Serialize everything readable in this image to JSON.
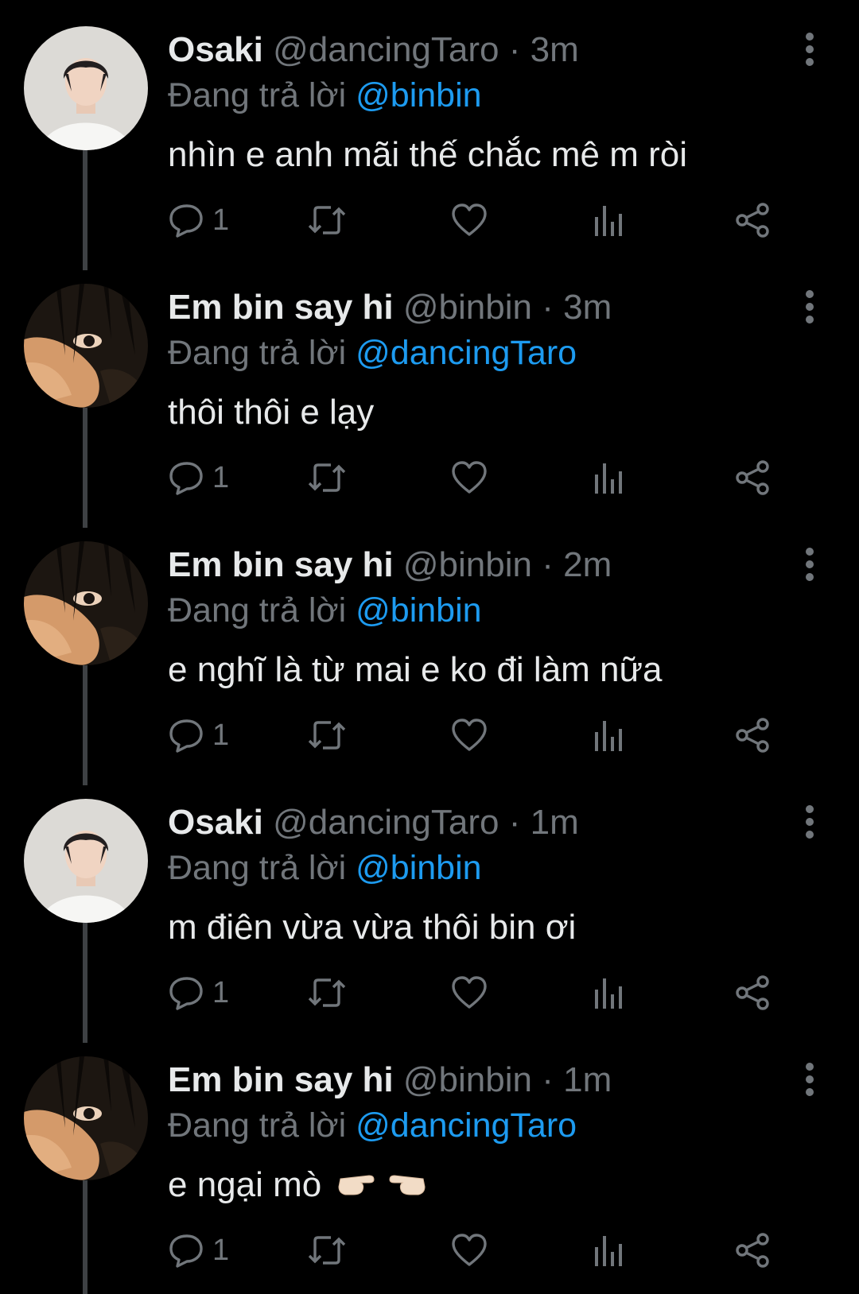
{
  "colors": {
    "background": "#000000",
    "primary_text": "#e7e9ea",
    "secondary_text": "#71767b",
    "link": "#1d9bf0",
    "thread_line": "#3e4144"
  },
  "tweets": [
    {
      "name": "Osaki",
      "handle": "@dancingTaro",
      "dot": "·",
      "time": "3m",
      "reply_prefix": "Đang trả lời",
      "reply_to": "@binbin",
      "text": "nhìn e anh mãi thế chắc mê m ròi",
      "reply_count": "1",
      "avatar": "osaki-avatar",
      "icons": [
        "reply-icon",
        "retweet-icon",
        "like-icon",
        "views-icon",
        "share-icon",
        "more-icon"
      ]
    },
    {
      "name": "Em bin say hi",
      "handle": "@binbin",
      "dot": "·",
      "time": "3m",
      "reply_prefix": "Đang trả lời",
      "reply_to": "@dancingTaro",
      "text": "thôi thôi e lạy",
      "reply_count": "1",
      "avatar": "binbin-avatar",
      "icons": [
        "reply-icon",
        "retweet-icon",
        "like-icon",
        "views-icon",
        "share-icon",
        "more-icon"
      ]
    },
    {
      "name": "Em bin say hi",
      "handle": "@binbin",
      "dot": "·",
      "time": "2m",
      "reply_prefix": "Đang trả lời",
      "reply_to": "@binbin",
      "text": "e nghĩ là từ mai e ko đi làm nữa",
      "reply_count": "1",
      "avatar": "binbin-avatar",
      "icons": [
        "reply-icon",
        "retweet-icon",
        "like-icon",
        "views-icon",
        "share-icon",
        "more-icon"
      ]
    },
    {
      "name": "Osaki",
      "handle": "@dancingTaro",
      "dot": "·",
      "time": "1m",
      "reply_prefix": "Đang trả lời",
      "reply_to": "@binbin",
      "text": "m điên vừa vừa thôi bin ơi",
      "reply_count": "1",
      "avatar": "osaki-avatar",
      "icons": [
        "reply-icon",
        "retweet-icon",
        "like-icon",
        "views-icon",
        "share-icon",
        "more-icon"
      ]
    },
    {
      "name": "Em bin say hi",
      "handle": "@binbin",
      "dot": "·",
      "time": "1m",
      "reply_prefix": "Đang trả lời",
      "reply_to": "@dancingTaro",
      "text": "e ngại mò",
      "text_emoji": "👉👈",
      "reply_count": "1",
      "avatar": "binbin-avatar",
      "icons": [
        "reply-icon",
        "retweet-icon",
        "like-icon",
        "views-icon",
        "share-icon",
        "more-icon"
      ]
    }
  ]
}
